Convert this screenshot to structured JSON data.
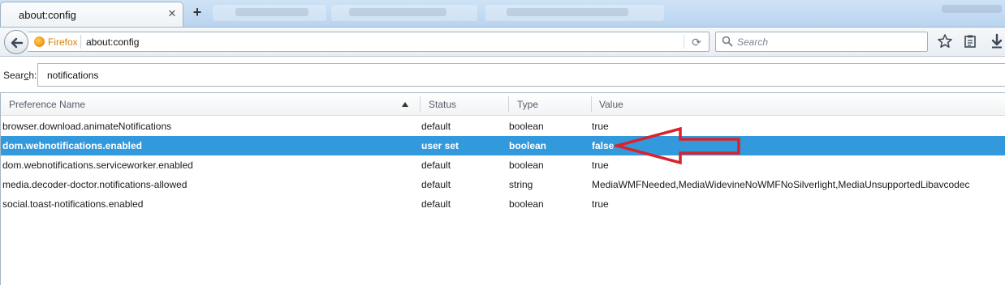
{
  "tabs": {
    "active_title": "about:config"
  },
  "navbar": {
    "identity_label": "Firefox",
    "url": "about:config",
    "search_placeholder": "Search"
  },
  "config": {
    "search_label_prefix": "Sear",
    "search_label_accel": "c",
    "search_label_suffix": "h:",
    "search_value": "notifications",
    "columns": {
      "name": "Preference Name",
      "status": "Status",
      "type": "Type",
      "value": "Value"
    },
    "rows": [
      {
        "name": "browser.download.animateNotifications",
        "status": "default",
        "type": "boolean",
        "value": "true"
      },
      {
        "name": "dom.webnotifications.enabled",
        "status": "user set",
        "type": "boolean",
        "value": "false"
      },
      {
        "name": "dom.webnotifications.serviceworker.enabled",
        "status": "default",
        "type": "boolean",
        "value": "true"
      },
      {
        "name": "media.decoder-doctor.notifications-allowed",
        "status": "default",
        "type": "string",
        "value": "MediaWMFNeeded,MediaWidevineNoWMFNoSilverlight,MediaUnsupportedLibavcodec"
      },
      {
        "name": "social.toast-notifications.enabled",
        "status": "default",
        "type": "boolean",
        "value": "true"
      }
    ],
    "selected_row_index": 1
  },
  "colors": {
    "selection": "#3399dd",
    "annotation_arrow": "#d9232a",
    "identity": "#d9820e"
  },
  "icons": {
    "back": "back-arrow-icon",
    "reload": "reload-icon",
    "search": "search-icon",
    "bookmark": "bookmark-star-icon",
    "reading_list": "clipboard-icon",
    "downloads": "download-arrow-icon",
    "close_tab": "close-icon",
    "new_tab": "plus-icon"
  }
}
